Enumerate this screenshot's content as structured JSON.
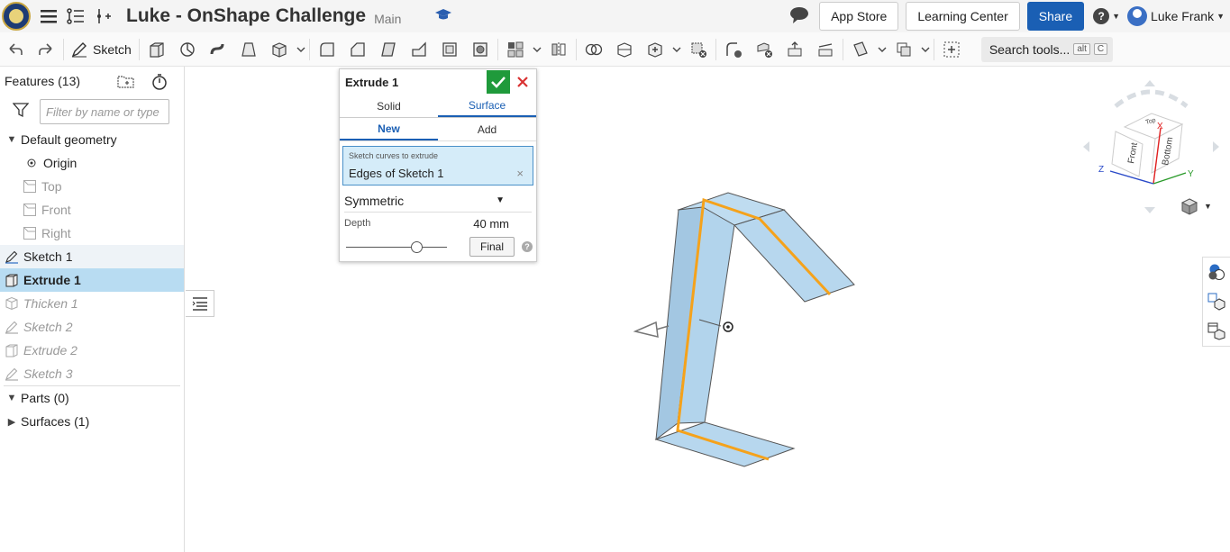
{
  "topbar": {
    "doc_title": "Luke - OnShape Challenge",
    "branch": "Main",
    "app_store": "App Store",
    "learning_center": "Learning Center",
    "share": "Share",
    "help_glyph": "?",
    "user_name": "Luke Frank"
  },
  "toolbar": {
    "sketch_label": "Sketch",
    "search_label": "Search tools...",
    "search_shortcut_1": "alt",
    "search_shortcut_2": "C"
  },
  "features": {
    "header": "Features (13)",
    "filter_placeholder": "Filter by name or type",
    "items": [
      {
        "label": "Default geometry"
      },
      {
        "label": "Origin"
      },
      {
        "label": "Top"
      },
      {
        "label": "Front"
      },
      {
        "label": "Right"
      },
      {
        "label": "Sketch 1"
      },
      {
        "label": "Extrude 1"
      },
      {
        "label": "Thicken 1"
      },
      {
        "label": "Sketch 2"
      },
      {
        "label": "Extrude 2"
      },
      {
        "label": "Sketch 3"
      },
      {
        "label": "Parts (0)"
      },
      {
        "label": "Surfaces (1)"
      }
    ]
  },
  "dialog": {
    "title": "Extrude 1",
    "tab_solid": "Solid",
    "tab_surface": "Surface",
    "tab_new": "New",
    "tab_add": "Add",
    "selection_label": "Sketch curves to extrude",
    "selection_value": "Edges of Sketch 1",
    "clear_glyph": "×",
    "end_type": "Symmetric",
    "depth_label": "Depth",
    "depth_value": "40 mm",
    "final_label": "Final",
    "help_glyph": "?",
    "slider_fraction": 0.7
  },
  "viewcube": {
    "face_front": "Front",
    "face_bottom": "Bottom",
    "face_top": "Top",
    "axis_x": "X",
    "axis_y": "Y",
    "axis_z": "Z"
  },
  "colors": {
    "accent": "#1a5fb4",
    "surface_fill": "#b7d7ee",
    "edge_highlight": "#f5a21b",
    "confirm": "#1f9a3b",
    "cancel": "#d93232"
  }
}
